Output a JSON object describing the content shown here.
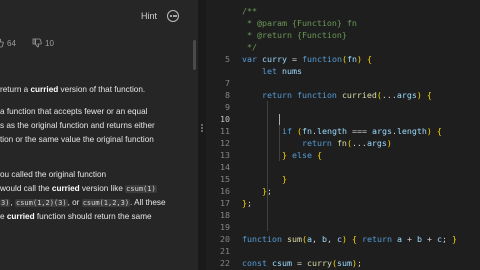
{
  "header": {
    "hint_label": "Hint"
  },
  "votes": {
    "likes": "64",
    "dislikes": "10"
  },
  "description": {
    "line1_pre": "return a ",
    "line1_bold": "curried",
    "line1_post": " version of that function.",
    "line2": "a function that accepts fewer or an equal",
    "line3": "s as the original function and returns either",
    "line4": "tion or the same value the original function",
    "line5": "ou called the original function",
    "line6_pre": " would call the ",
    "line6_bold": "curried",
    "line6_post": " version like ",
    "line6_code": "csum(1)",
    "line7_code1": "3)",
    "line7_sep1": ", ",
    "line7_code2": "csum(1,2)(3)",
    "line7_sep2": ", or ",
    "line7_code3": "csum(1,2,3)",
    "line7_post": ". All these",
    "line8_pre": "e ",
    "line8_bold": "curried",
    "line8_post": " function should return the same"
  },
  "code_lines": [
    {
      "n": "",
      "t": "/**"
    },
    {
      "n": "",
      "t": " * @param {Function} fn"
    },
    {
      "n": "",
      "t": " * @return {Function}"
    },
    {
      "n": "",
      "t": " */"
    },
    {
      "n": "5",
      "t": "var curry = function(fn) {"
    },
    {
      "n": "",
      "t": "    let nums"
    },
    {
      "n": "7",
      "t": ""
    },
    {
      "n": "8",
      "t": "    return function curried(...args) {"
    },
    {
      "n": "9",
      "t": ""
    },
    {
      "n": "10",
      "t": ""
    },
    {
      "n": "11",
      "t": "        if (fn.length === args.length) {"
    },
    {
      "n": "12",
      "t": "            return fn(...args)"
    },
    {
      "n": "13",
      "t": "        } else {"
    },
    {
      "n": "14",
      "t": ""
    },
    {
      "n": "15",
      "t": "        }"
    },
    {
      "n": "16",
      "t": "    };"
    },
    {
      "n": "17",
      "t": "};"
    },
    {
      "n": "18",
      "t": ""
    },
    {
      "n": "19",
      "t": ""
    },
    {
      "n": "20",
      "t": "function sum(a, b, c) { return a + b + c; }"
    },
    {
      "n": "21",
      "t": ""
    },
    {
      "n": "22",
      "t": "const csum = curry(sum);"
    }
  ],
  "colors": {
    "editor_bg": "#1e1e1e",
    "panel_bg": "#262626",
    "keyword": "#569cd6",
    "comment": "#6a9955"
  }
}
